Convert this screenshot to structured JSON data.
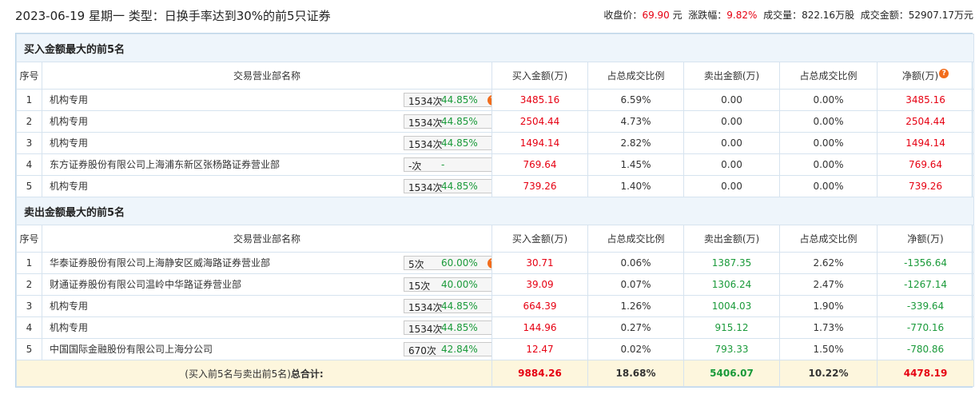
{
  "header": {
    "title": "2023-06-19 星期一 类型：日换手率达到30%的前5只证券",
    "close_label": "收盘价：",
    "close_value": "69.90",
    "close_unit": "元",
    "change_label": "涨跌幅：",
    "change_value": "9.82%",
    "volume_label": "成交量：",
    "volume_value": "822.16万股",
    "amount_label": "成交金额：",
    "amount_value": "52907.17万元"
  },
  "buy_section": {
    "title": "买入金额最大的前5名",
    "columns": [
      "序号",
      "交易营业部名称",
      "买入金额(万)",
      "占总成交比例",
      "卖出金额(万)",
      "占总成交比例",
      "净额(万)"
    ],
    "rows": [
      {
        "idx": "1",
        "name": "机构专用",
        "count": "1534次",
        "pct": "44.85%",
        "badge_icon": "question",
        "buy": "3485.16",
        "buy_ratio": "6.59%",
        "sell": "0.00",
        "sell_ratio": "0.00%",
        "net": "3485.16"
      },
      {
        "idx": "2",
        "name": "机构专用",
        "count": "1534次",
        "pct": "44.85%",
        "badge_icon": "arrow",
        "buy": "2504.44",
        "buy_ratio": "4.73%",
        "sell": "0.00",
        "sell_ratio": "0.00%",
        "net": "2504.44"
      },
      {
        "idx": "3",
        "name": "机构专用",
        "count": "1534次",
        "pct": "44.85%",
        "badge_icon": "arrow",
        "buy": "1494.14",
        "buy_ratio": "2.82%",
        "sell": "0.00",
        "sell_ratio": "0.00%",
        "net": "1494.14"
      },
      {
        "idx": "4",
        "name": "东方证券股份有限公司上海浦东新区张杨路证券营业部",
        "count": "-次",
        "pct": "-",
        "badge_icon": "arrow",
        "buy": "769.64",
        "buy_ratio": "1.45%",
        "sell": "0.00",
        "sell_ratio": "0.00%",
        "net": "769.64"
      },
      {
        "idx": "5",
        "name": "机构专用",
        "count": "1534次",
        "pct": "44.85%",
        "badge_icon": "arrow",
        "buy": "739.26",
        "buy_ratio": "1.40%",
        "sell": "0.00",
        "sell_ratio": "0.00%",
        "net": "739.26"
      }
    ]
  },
  "sell_section": {
    "title": "卖出金额最大的前5名",
    "columns": [
      "序号",
      "交易营业部名称",
      "买入金额(万)",
      "占总成交比例",
      "卖出金额(万)",
      "占总成交比例",
      "净额(万)"
    ],
    "rows": [
      {
        "idx": "1",
        "name": "华泰证券股份有限公司上海静安区威海路证券营业部",
        "count": "5次",
        "pct": "60.00%",
        "badge_icon": "question",
        "buy": "30.71",
        "buy_ratio": "0.06%",
        "sell": "1387.35",
        "sell_ratio": "2.62%",
        "net": "-1356.64"
      },
      {
        "idx": "2",
        "name": "财通证券股份有限公司温岭中华路证券营业部",
        "count": "15次",
        "pct": "40.00%",
        "badge_icon": "arrow",
        "buy": "39.09",
        "buy_ratio": "0.07%",
        "sell": "1306.24",
        "sell_ratio": "2.47%",
        "net": "-1267.14"
      },
      {
        "idx": "3",
        "name": "机构专用",
        "count": "1534次",
        "pct": "44.85%",
        "badge_icon": "arrow",
        "buy": "664.39",
        "buy_ratio": "1.26%",
        "sell": "1004.03",
        "sell_ratio": "1.90%",
        "net": "-339.64"
      },
      {
        "idx": "4",
        "name": "机构专用",
        "count": "1534次",
        "pct": "44.85%",
        "badge_icon": "arrow",
        "buy": "144.96",
        "buy_ratio": "0.27%",
        "sell": "915.12",
        "sell_ratio": "1.73%",
        "net": "-770.16"
      },
      {
        "idx": "5",
        "name": "中国国际金融股份有限公司上海分公司",
        "count": "670次",
        "pct": "42.84%",
        "badge_icon": "arrow",
        "buy": "12.47",
        "buy_ratio": "0.02%",
        "sell": "793.33",
        "sell_ratio": "1.50%",
        "net": "-780.86"
      }
    ]
  },
  "total": {
    "label_prefix": "(买入前5名与卖出前5名)",
    "label_bold": "总合计:",
    "buy": "9884.26",
    "buy_ratio": "18.68%",
    "sell": "5406.07",
    "sell_ratio": "10.22%",
    "net": "4478.19"
  },
  "colors": {
    "up": "#e60012",
    "down": "#1a9a3a",
    "section_bg": "#eef5fb",
    "total_bg": "#fdf6dd",
    "help_icon": "#f26c1b"
  }
}
